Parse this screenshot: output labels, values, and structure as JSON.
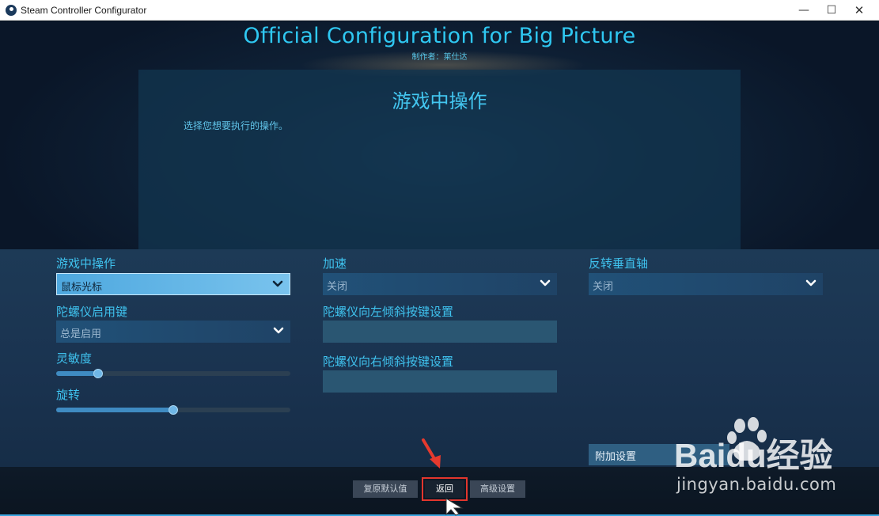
{
  "window": {
    "title": "Steam Controller Configurator",
    "min_glyph": "—",
    "max_glyph": "☐",
    "close_glyph": "✕"
  },
  "header": {
    "title": "Official Configuration for Big Picture",
    "author": "制作者：莱仕达"
  },
  "panel": {
    "heading": "游戏中操作",
    "description": "选择您想要执行的操作。"
  },
  "settings": {
    "in_game_action": {
      "label": "游戏中操作",
      "value": "鼠标光标"
    },
    "gyro_enable_button": {
      "label": "陀螺仪启用键",
      "value": "总是启用"
    },
    "sensitivity": {
      "label": "灵敏度",
      "level": 0.18
    },
    "rotation": {
      "label": "旋转",
      "level": 0.5
    },
    "acceleration": {
      "label": "加速",
      "value": "关闭"
    },
    "gyro_tilt_left": {
      "label": "陀螺仪向左倾斜按键设置",
      "value": ""
    },
    "gyro_tilt_right": {
      "label": "陀螺仪向右倾斜按键设置",
      "value": ""
    },
    "invert_vertical": {
      "label": "反转垂直轴",
      "value": "关闭"
    },
    "additional_settings": "附加设置"
  },
  "footer": {
    "restore_defaults": "复原默认值",
    "back": "返回",
    "advanced": "高级设置"
  },
  "watermark": {
    "brand": "Baidu经验",
    "url": "jingyan.baidu.com"
  },
  "colors": {
    "accent": "#2fc8f2",
    "highlight": "#e3362d"
  },
  "icons": [
    "steam-icon",
    "chevron-down-icon",
    "red-arrow-icon",
    "mouse-cursor-icon",
    "baidu-paw-icon"
  ]
}
